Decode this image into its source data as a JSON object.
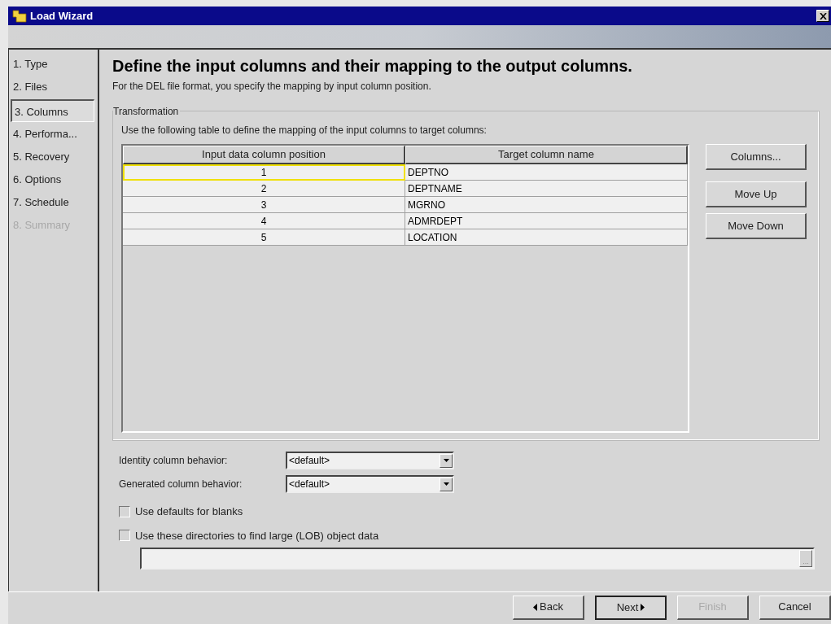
{
  "window": {
    "title": "Load Wizard"
  },
  "steps": [
    {
      "label": "1. Type",
      "selected": false,
      "disabled": false
    },
    {
      "label": "2. Files",
      "selected": false,
      "disabled": false
    },
    {
      "label": "3. Columns",
      "selected": true,
      "disabled": false
    },
    {
      "label": "4. Performa...",
      "selected": false,
      "disabled": false
    },
    {
      "label": "5. Recovery",
      "selected": false,
      "disabled": false
    },
    {
      "label": "6. Options",
      "selected": false,
      "disabled": false
    },
    {
      "label": "7. Schedule",
      "selected": false,
      "disabled": false
    },
    {
      "label": "8. Summary",
      "selected": false,
      "disabled": true
    }
  ],
  "heading": "Define the input columns and their mapping to the output columns.",
  "description": "For the DEL file format, you specify the mapping by input column position.",
  "transformation": {
    "title": "Transformation",
    "instruction": "Use the following table to define the mapping of the input columns to target columns:",
    "table": {
      "columns": [
        "Input data column position",
        "Target column name"
      ],
      "rows": [
        {
          "cells": [
            "1",
            "DEPTNO"
          ],
          "focused": true
        },
        {
          "cells": [
            "2",
            "DEPTNAME"
          ],
          "focused": false
        },
        {
          "cells": [
            "3",
            "MGRNO"
          ],
          "focused": false
        },
        {
          "cells": [
            "4",
            "ADMRDEPT"
          ],
          "focused": false
        },
        {
          "cells": [
            "5",
            "LOCATION"
          ],
          "focused": false
        }
      ]
    },
    "buttons": [
      "Columns...",
      "Move Up",
      "Move Down"
    ]
  },
  "selects": [
    {
      "label": "Identity column behavior:",
      "value": "<default>"
    },
    {
      "label": "Generated column behavior:",
      "value": "<default>"
    }
  ],
  "checkboxes": [
    {
      "label": "Use defaults for blanks",
      "checked": false
    },
    {
      "label": "Use these directories to find large (LOB) object data",
      "checked": false
    }
  ],
  "lob_path": {
    "browse": "..."
  },
  "footer_buttons": [
    {
      "label": "Back",
      "kind": "back",
      "disabled": false,
      "default": false
    },
    {
      "label": "Next",
      "kind": "next",
      "disabled": false,
      "default": true
    },
    {
      "label": "Finish",
      "kind": "plain",
      "disabled": true,
      "default": false
    },
    {
      "label": "Cancel",
      "kind": "plain",
      "disabled": false,
      "default": false
    }
  ]
}
